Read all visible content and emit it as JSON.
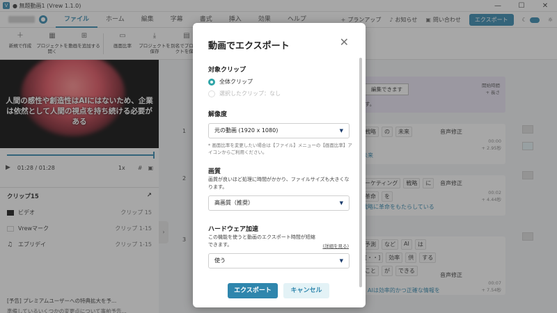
{
  "titlebar": {
    "title": "● 無題動画1 (Vrew 1.1.0)",
    "logo": "V",
    "minimize": "—",
    "maximize": "☐",
    "close": "✕"
  },
  "menubar": {
    "tabs": [
      "ファイル",
      "ホーム",
      "編集",
      "字幕",
      "書式",
      "挿入",
      "効果",
      "ヘルプ"
    ],
    "active_tab": "ファイル",
    "plan_upgrade": "プランアップ",
    "notice": "お知らせ",
    "contact": "問い合わせ",
    "export": "エクスポート"
  },
  "ribbon": {
    "new": "新規で作成",
    "open": "プロジェクトを開く",
    "add_video": "動画を追加する",
    "aspect": "画面比率",
    "save": "プロジェクトを保存",
    "save_as": "別名でプロジェクトを保存"
  },
  "player": {
    "caption": "人間の感性や創造性はAIにはないため、企業は依然として人間の視点を持ち続ける必要がある",
    "time": "01:28 / 01:28",
    "speed": "1x",
    "progress": 1.0
  },
  "clip_panel": {
    "title": "クリップ15",
    "rows": [
      {
        "label": "ビデオ",
        "value": "クリップ 15",
        "color": "#111111"
      },
      {
        "label": "Vrewマーク",
        "value": "クリップ 1-15",
        "color": "#ffffff"
      },
      {
        "label": "エブリデイ",
        "value": "クリップ 1-15",
        "color": "#333333"
      }
    ]
  },
  "notice": {
    "line1": "[予告] プレミアムユーザーへの特典拡大を予...",
    "line2": "準備しているいくつかの変更点について事前予告..."
  },
  "editor": {
    "banner_button": "編集できます",
    "banner_right1": "開始時間",
    "banner_right2": "+ 長さ",
    "banner_sub": "す。",
    "rows": [
      {
        "num": "1",
        "words": [
          "戦略",
          "の",
          "未来"
        ],
        "voice": "音声修正",
        "time": "00:00",
        "dur": "+ 2.95秒",
        "sub": "未来"
      },
      {
        "num": "2",
        "words": [
          "ーケティング",
          "戦略",
          "に",
          "革命",
          "を"
        ],
        "voice": "音声修正",
        "time": "00:02",
        "dur": "+ 4.44秒",
        "sub": "戦略に革命をもたらしている"
      },
      {
        "num": "3",
        "words": [
          "予測",
          "など",
          "AI",
          "は",
          "[・・]",
          "効率",
          "供",
          "する",
          "こと",
          "が",
          "できる"
        ],
        "voice": "音声修正",
        "time": "00:07",
        "dur": "+ 7.54秒",
        "sub": "、AIは効率的かつ正確な情報を"
      }
    ]
  },
  "dialog": {
    "title": "動画でエクスポート",
    "target_label": "対象クリップ",
    "target_all": "全体クリップ",
    "target_selected": "選択したクリップ：なし",
    "resolution_label": "解像度",
    "resolution_value": "元の動画 (1920 x 1080)",
    "resolution_note": "* 画面比率を変更したい場合は【ファイル】メニューの【画面比率】アイコンからご利用ください。",
    "quality_label": "画質",
    "quality_desc": "画質が良いほど処理に時間がかかり、ファイルサイズも大きくなります。",
    "quality_value": "高画質（推奨）",
    "hw_label": "ハードウェア加速",
    "hw_desc": "この機能を使うと動画のエクスポート時間が短縮できます。",
    "hw_link": "(詳細を見る)",
    "hw_value": "使う",
    "export_button": "エクスポート",
    "cancel_button": "キャンセル"
  }
}
